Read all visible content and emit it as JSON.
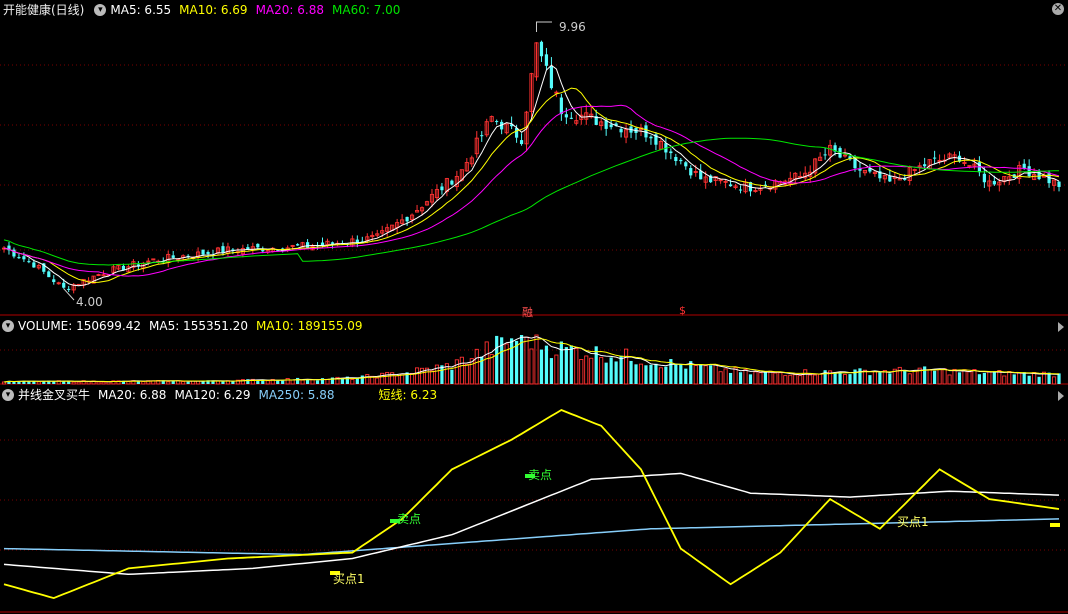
{
  "price_panel": {
    "title": "开能健康(日线)",
    "ma5": "MA5: 6.55",
    "ma10": "MA10: 6.69",
    "ma20": "MA20: 6.88",
    "ma60": "MA60: 7.00",
    "high_label": "9.96",
    "low_label": "4.00",
    "marker_left": "融",
    "marker_right": "$"
  },
  "volume_panel": {
    "title": "VOLUME: 150699.42",
    "ma5": "MA5: 155351.20",
    "ma10": "MA10: 189155.09"
  },
  "indicator_panel": {
    "title": "并线金叉买牛",
    "ma20": "MA20: 6.88",
    "ma120": "MA120: 6.29",
    "ma250": "MA250: 5.88",
    "short_line": "短线: 6.23",
    "annotations": [
      "卖点",
      "卖点",
      "买点1",
      "买点1"
    ]
  },
  "colors": {
    "up": "#ff3232",
    "down": "#54fcfc",
    "ma5": "#ffffff",
    "ma10": "#ffff00",
    "ma20": "#ff00ff",
    "ma60": "#00e600",
    "grid": "#7a0000",
    "short": "#ffff00",
    "ma120": "#ffffff",
    "ma250": "#87cefa"
  },
  "chart_data": {
    "type": "candlestick",
    "price_anchors": [
      [
        0,
        5.0
      ],
      [
        6,
        4.6
      ],
      [
        12,
        4.0
      ],
      [
        20,
        4.4
      ],
      [
        30,
        4.7
      ],
      [
        45,
        4.95
      ],
      [
        62,
        5.05
      ],
      [
        75,
        5.25
      ],
      [
        82,
        5.85
      ],
      [
        92,
        6.9
      ],
      [
        98,
        8.2
      ],
      [
        104,
        7.7
      ],
      [
        107,
        9.96
      ],
      [
        112,
        8.4
      ],
      [
        120,
        8.1
      ],
      [
        130,
        7.8
      ],
      [
        140,
        6.7
      ],
      [
        150,
        6.5
      ],
      [
        160,
        6.75
      ],
      [
        166,
        7.4
      ],
      [
        172,
        6.9
      ],
      [
        178,
        6.6
      ],
      [
        186,
        7.1
      ],
      [
        192,
        7.25
      ],
      [
        198,
        6.6
      ],
      [
        205,
        6.95
      ],
      [
        212,
        6.55
      ]
    ],
    "volume_anchors": [
      [
        0,
        0.05
      ],
      [
        40,
        0.06
      ],
      [
        70,
        0.12
      ],
      [
        80,
        0.22
      ],
      [
        90,
        0.38
      ],
      [
        104,
        1.0
      ],
      [
        110,
        0.75
      ],
      [
        122,
        0.6
      ],
      [
        134,
        0.42
      ],
      [
        150,
        0.22
      ],
      [
        170,
        0.25
      ],
      [
        185,
        0.28
      ],
      [
        200,
        0.22
      ],
      [
        212,
        0.2
      ]
    ],
    "short_line": [
      [
        0,
        0.12
      ],
      [
        10,
        0.05
      ],
      [
        25,
        0.2
      ],
      [
        45,
        0.25
      ],
      [
        70,
        0.28
      ],
      [
        80,
        0.45
      ],
      [
        90,
        0.7
      ],
      [
        102,
        0.85
      ],
      [
        112,
        1.0
      ],
      [
        120,
        0.92
      ],
      [
        128,
        0.7
      ],
      [
        136,
        0.3
      ],
      [
        146,
        0.12
      ],
      [
        156,
        0.28
      ],
      [
        166,
        0.55
      ],
      [
        176,
        0.4
      ],
      [
        188,
        0.7
      ],
      [
        198,
        0.55
      ],
      [
        212,
        0.5
      ]
    ],
    "ma120_line": [
      [
        0,
        0.22
      ],
      [
        25,
        0.17
      ],
      [
        50,
        0.2
      ],
      [
        70,
        0.25
      ],
      [
        90,
        0.37
      ],
      [
        105,
        0.52
      ],
      [
        118,
        0.65
      ],
      [
        136,
        0.68
      ],
      [
        150,
        0.58
      ],
      [
        170,
        0.56
      ],
      [
        190,
        0.59
      ],
      [
        212,
        0.57
      ]
    ],
    "ma250_line": [
      [
        0,
        0.3
      ],
      [
        60,
        0.27
      ],
      [
        130,
        0.4
      ],
      [
        212,
        0.45
      ]
    ],
    "price_range": [
      3.6,
      10.6
    ],
    "candle_count": 213
  }
}
